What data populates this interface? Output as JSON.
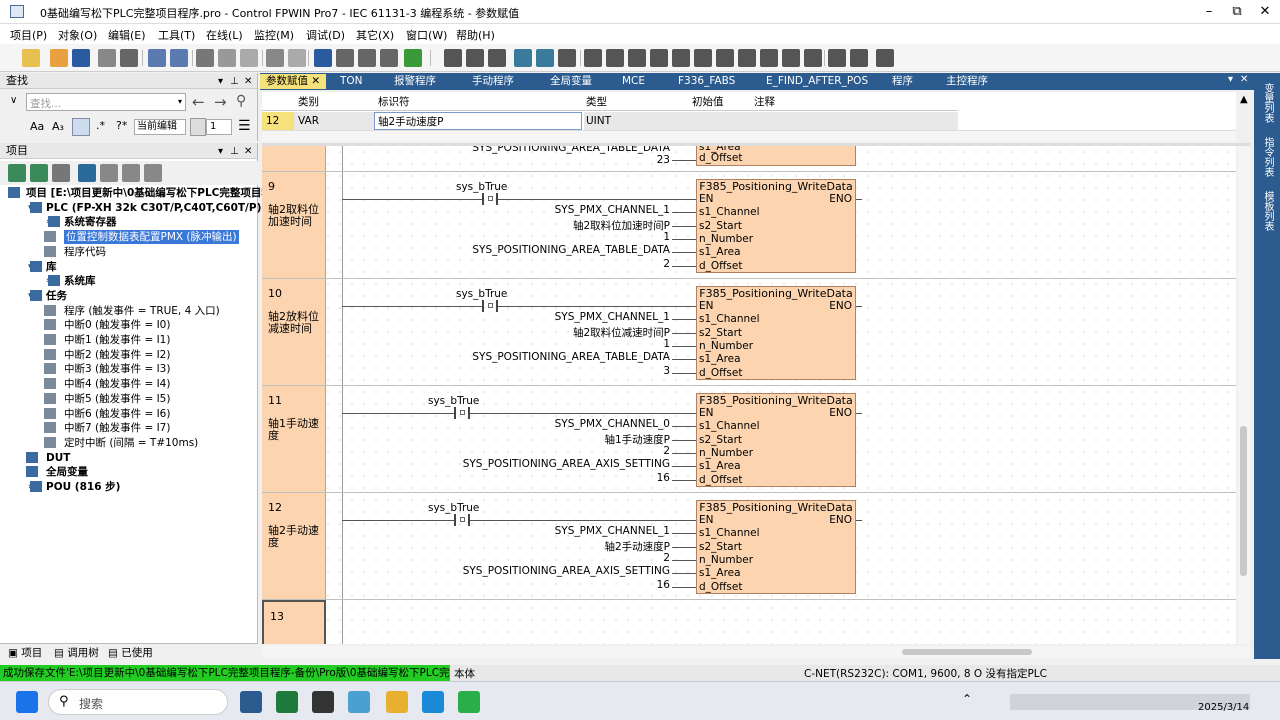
{
  "window": {
    "title": "0基础编写松下PLC完整项目程序.pro - Control FPWIN Pro7 - IEC 61131-3 编程系统 - 参数赋值",
    "min": "–",
    "max": "⧉",
    "close": "✕"
  },
  "menu": [
    "项目(P)",
    "对象(O)",
    "编辑(E)",
    "工具(T)",
    "在线(L)",
    "监控(M)",
    "调试(D)",
    "其它(X)",
    "窗口(W)",
    "帮助(H)"
  ],
  "find": {
    "title": "查找",
    "placeholder": "查找...",
    "scope": "当前编辑",
    "count": "1"
  },
  "project": {
    "title": "项目",
    "tree": [
      {
        "label": "项目 [E:\\项目更新中\\0基础编写松下PLC完整项目程",
        "bold": true,
        "x": 26,
        "tri": ""
      },
      {
        "label": "PLC (FP-XH 32k C30T/P,C40T,C60T/P)",
        "bold": true,
        "x": 46,
        "tri": "▾"
      },
      {
        "label": "系统寄存器",
        "bold": true,
        "x": 64,
        "tri": "›"
      },
      {
        "label": "位置控制数据表配置PMX (脉冲输出)",
        "bold": false,
        "x": 64,
        "tri": "",
        "sel": true
      },
      {
        "label": "程序代码",
        "bold": false,
        "x": 64,
        "tri": ""
      },
      {
        "label": "库",
        "bold": true,
        "x": 46,
        "tri": "▾"
      },
      {
        "label": "系统库",
        "bold": true,
        "x": 64,
        "tri": "›"
      },
      {
        "label": "任务",
        "bold": true,
        "x": 46,
        "tri": "▾"
      },
      {
        "label": "程序 (触发事件 = TRUE, 4 入口)",
        "bold": false,
        "x": 64,
        "tri": ""
      },
      {
        "label": "中断0 (触发事件 = I0)",
        "bold": false,
        "x": 64,
        "tri": ""
      },
      {
        "label": "中断1 (触发事件 = I1)",
        "bold": false,
        "x": 64,
        "tri": ""
      },
      {
        "label": "中断2 (触发事件 = I2)",
        "bold": false,
        "x": 64,
        "tri": ""
      },
      {
        "label": "中断3 (触发事件 = I3)",
        "bold": false,
        "x": 64,
        "tri": ""
      },
      {
        "label": "中断4 (触发事件 = I4)",
        "bold": false,
        "x": 64,
        "tri": ""
      },
      {
        "label": "中断5 (触发事件 = I5)",
        "bold": false,
        "x": 64,
        "tri": ""
      },
      {
        "label": "中断6 (触发事件 = I6)",
        "bold": false,
        "x": 64,
        "tri": ""
      },
      {
        "label": "中断7 (触发事件 = I7)",
        "bold": false,
        "x": 64,
        "tri": ""
      },
      {
        "label": "定时中断 (间隔 = T#10ms)",
        "bold": false,
        "x": 64,
        "tri": ""
      },
      {
        "label": "DUT",
        "bold": true,
        "x": 46,
        "tri": ""
      },
      {
        "label": "全局变量",
        "bold": true,
        "x": 46,
        "tri": ""
      },
      {
        "label": "POU (816 步)",
        "bold": true,
        "x": 46,
        "tri": "›"
      }
    ]
  },
  "bottom_tabs": [
    "项目",
    "调用树",
    "已使用"
  ],
  "doc_tabs": [
    "参数赋值",
    "TON",
    "报警程序",
    "手动程序",
    "全局变量",
    "MCE",
    "F336_FABS",
    "E_FIND_AFTER_POS",
    "程序",
    "主控程序"
  ],
  "var_table": {
    "headers": [
      "类别",
      "标识符",
      "类型",
      "初始值",
      "注释"
    ],
    "row": {
      "num": "12",
      "class": "VAR",
      "id": "轴2手动速度P",
      "type": "UINT",
      "init": "",
      "comment": ""
    }
  },
  "top_partial": {
    "area": "SYS_POSITIONING_AREA_TABLE_DATA",
    "offset": "23",
    "p1": "s1_Area",
    "p2": "d_Offset"
  },
  "networks": [
    {
      "num": "9",
      "comment": "轴2取料位加速时间",
      "contact": "sys_bTrue",
      "fb": "F385_Positioning_WriteData",
      "ch": "SYS_PMX_CHANNEL_1",
      "start": "轴2取料位加速时间P",
      "n": "1",
      "area": "SYS_POSITIONING_AREA_TABLE_DATA",
      "offset": "2"
    },
    {
      "num": "10",
      "comment": "轴2放料位减速时间",
      "contact": "sys_bTrue",
      "fb": "F385_Positioning_WriteData",
      "ch": "SYS_PMX_CHANNEL_1",
      "start": "轴2取料位减速时间P",
      "n": "1",
      "area": "SYS_POSITIONING_AREA_TABLE_DATA",
      "offset": "3"
    },
    {
      "num": "11",
      "comment": "轴1手动速度",
      "contact": "sys_bTrue",
      "fb": "F385_Positioning_WriteData",
      "ch": "SYS_PMX_CHANNEL_0",
      "start": "轴1手动速度P",
      "n": "2",
      "area": "SYS_POSITIONING_AREA_AXIS_SETTING",
      "offset": "16"
    },
    {
      "num": "12",
      "comment": "轴2手动速度",
      "contact": "sys_bTrue",
      "fb": "F385_Positioning_WriteData",
      "ch": "SYS_PMX_CHANNEL_1",
      "start": "轴2手动速度P",
      "n": "2",
      "area": "SYS_POSITIONING_AREA_AXIS_SETTING",
      "offset": "16"
    },
    {
      "num": "13",
      "comment": ""
    }
  ],
  "pins": {
    "en": "EN",
    "eno": "ENO",
    "ch": "s1_Channel",
    "start": "s2_Start",
    "n": "n_Number",
    "area": "s1_Area",
    "offset": "d_Offset"
  },
  "right_tabs": [
    "变量列表",
    "指令列表",
    "模板列表"
  ],
  "status": {
    "left": "成功保存文件'E:\\项目更新中\\0基础编写松下PLC完整项目程序-备份\\Pro版\\0基础编写松下PLC完整项",
    "mid": "本体",
    "right": "C-NET(RS232C): COM1, 9600, 8 O  没有指定PLC"
  },
  "taskbar": {
    "search": "搜索",
    "date": "2025/3/14"
  },
  "colors": {
    "accent": "#2b5b8f",
    "block": "#fcd5b0",
    "status_green": "#22cc22"
  }
}
